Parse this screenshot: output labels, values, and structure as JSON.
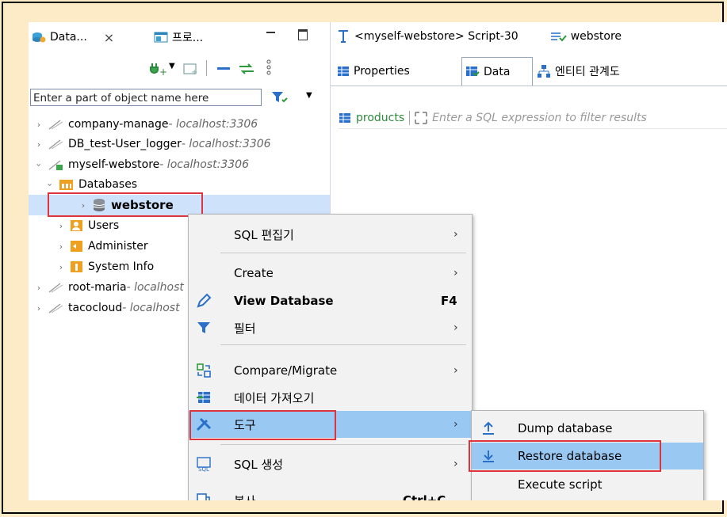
{
  "nav": {
    "tabs": [
      {
        "label": "Data...",
        "close": "×"
      },
      {
        "label": "프로..."
      }
    ],
    "filter_placeholder": "Enter a part of object name here",
    "tree": [
      {
        "name": "company-manage",
        "host": " - localhost:3306"
      },
      {
        "name": "DB_test-User_logger",
        "host": " - localhost:3306"
      },
      {
        "name": "myself-webstore",
        "host": " - localhost:3306"
      },
      {
        "name": "Databases"
      },
      {
        "name": "webstore"
      },
      {
        "name": "Users"
      },
      {
        "name": "Administer"
      },
      {
        "name": "System Info"
      },
      {
        "name": "root-maria",
        "host": " - localhost"
      },
      {
        "name": "tacocloud",
        "host": " - localhost"
      }
    ]
  },
  "editor": {
    "title": "<myself-webstore> Script-30",
    "schema": "webstore",
    "tabs": [
      "Properties",
      "Data",
      "엔티티 관계도"
    ],
    "table_name": "products",
    "filter_placeholder": "Enter a SQL expression to filter results"
  },
  "menu": {
    "items": [
      {
        "label": "SQL 편집기",
        "arrow": "›"
      },
      {
        "label": "Create",
        "arrow": "›"
      },
      {
        "label": "View Database",
        "shortcut": "F4"
      },
      {
        "label": "필터",
        "arrow": "›"
      },
      {
        "label": "Compare/Migrate",
        "arrow": "›"
      },
      {
        "label": "데이터 가져오기"
      },
      {
        "label": "도구",
        "arrow": "›"
      },
      {
        "label": "SQL 생성",
        "arrow": "›"
      },
      {
        "label": "복사",
        "shortcut": "Ctrl+C"
      }
    ]
  },
  "submenu": {
    "items": [
      "Dump database",
      "Restore database",
      "Execute script"
    ]
  },
  "colors": {
    "accent": "#e0343d",
    "highlight": "#99c9f3",
    "selection": "#cfe2fb",
    "background": "#fdebc8"
  }
}
